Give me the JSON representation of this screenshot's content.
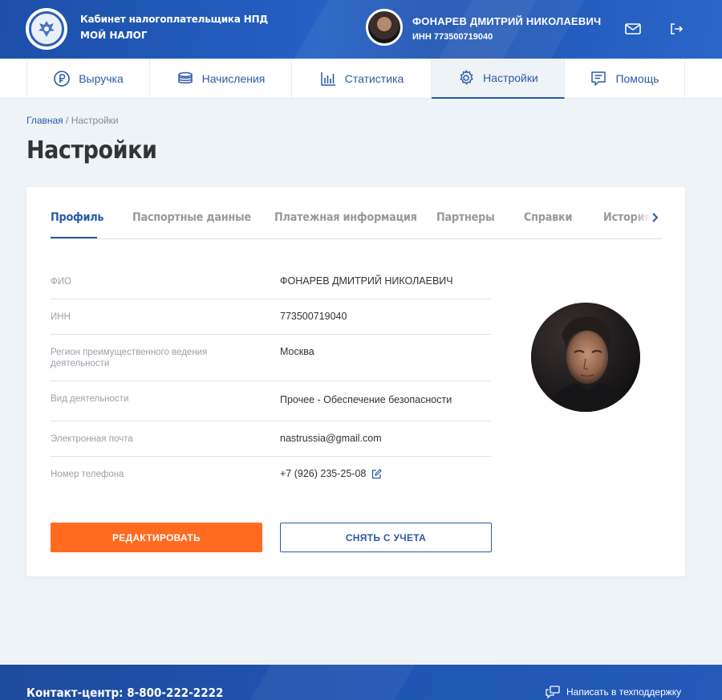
{
  "header": {
    "brand_line1": "Кабинет налогоплательщика НПД",
    "brand_line2": "МОЙ НАЛОГ",
    "user_name": "ФОНАРЕВ ДМИТРИЙ НИКОЛАЕВИЧ",
    "user_inn": "ИНН 773500719040",
    "icons": [
      "mail-icon",
      "logout-icon"
    ]
  },
  "nav": {
    "items": [
      {
        "label": "Выручка",
        "icon": "ruble-icon"
      },
      {
        "label": "Начисления",
        "icon": "coins-icon"
      },
      {
        "label": "Статистика",
        "icon": "stats-icon"
      },
      {
        "label": "Настройки",
        "icon": "gear-icon",
        "active": true
      },
      {
        "label": "Помощь",
        "icon": "help-icon"
      }
    ]
  },
  "breadcrumb": {
    "home": "Главная",
    "separator": "/",
    "current": "Настройки"
  },
  "page_title": "Настройки",
  "tabs": [
    {
      "label": "Профиль",
      "active": true
    },
    {
      "label": "Паспортные данные"
    },
    {
      "label": "Платежная информация"
    },
    {
      "label": "Партнеры"
    },
    {
      "label": "Справки"
    },
    {
      "label": "История"
    }
  ],
  "profile": {
    "rows": [
      {
        "label": "ФИО",
        "value": "ФОНАРЕВ ДМИТРИЙ НИКОЛАЕВИЧ"
      },
      {
        "label": "ИНН",
        "value": "773500719040"
      },
      {
        "label": "Регион преимущественного ведения деятельности",
        "value": "Москва"
      },
      {
        "label": "Вид деятельности",
        "value": "Прочее - Обеспечение безопасности"
      },
      {
        "label": "Электронная почта",
        "value": "nastrussia@gmail.com"
      },
      {
        "label": "Номер телефона",
        "value": "+7 (926) 235-25-08"
      }
    ],
    "edit_button": "РЕДАКТИРОВАТЬ",
    "unregister_button": "СНЯТЬ С УЧЕТА"
  },
  "footer": {
    "contact": "Контакт-центр: 8-800-222-2222",
    "support": "Написать в техподдержку"
  },
  "colors": {
    "brand_blue": "#2b5aa6",
    "header_blue": "#2560c4",
    "accent_orange": "#ff6b1f",
    "page_bg": "#eef3f8"
  }
}
